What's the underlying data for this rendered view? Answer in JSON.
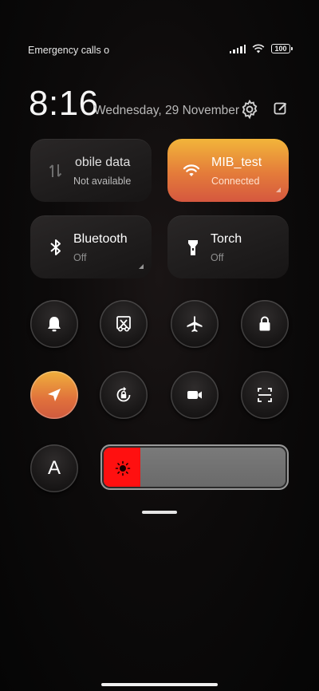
{
  "status_bar": {
    "left_text": "Emergency calls o",
    "battery": "100"
  },
  "header": {
    "time": "8:16",
    "date": "Wednesday, 29 November"
  },
  "tiles": {
    "mobile_data": {
      "title": "obile data",
      "subtitle": "Not available",
      "icon": "mobile-data-arrows-icon"
    },
    "wifi": {
      "title": "MIB_test",
      "subtitle": "Connected",
      "icon": "wifi-icon",
      "accent": "#e47b3a"
    },
    "bluetooth": {
      "title": "Bluetooth",
      "subtitle": "Off",
      "icon": "bluetooth-icon"
    },
    "torch": {
      "title": "Torch",
      "subtitle": "Off",
      "icon": "torch-icon"
    }
  },
  "round_buttons": [
    {
      "icon": "bell-icon"
    },
    {
      "icon": "screenshot-scissors-icon"
    },
    {
      "icon": "airplane-icon"
    },
    {
      "icon": "lock-icon"
    },
    {
      "icon": "location-arrow-icon",
      "active": true
    },
    {
      "icon": "rotation-lock-icon"
    },
    {
      "icon": "video-camera-icon"
    },
    {
      "icon": "scan-icon"
    }
  ],
  "auto_brightness": {
    "label": "A"
  },
  "brightness": {
    "level": 0.2,
    "fill_color": "#ff1010",
    "icon": "sun-icon"
  }
}
